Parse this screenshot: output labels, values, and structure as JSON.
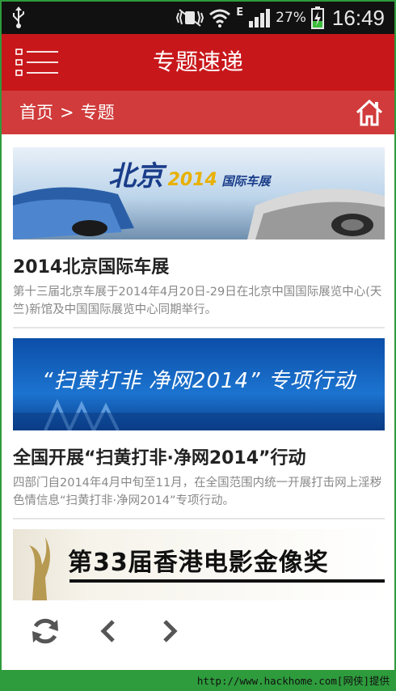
{
  "status_bar": {
    "network_type": "E",
    "battery_percent": "27%",
    "time": "16:49",
    "icons": [
      "usb-icon",
      "mute-vibrate-icon",
      "wifi-icon",
      "signal-icon",
      "battery-charging-icon"
    ]
  },
  "header": {
    "title": "专题速递",
    "menu_icon": "list-menu-icon"
  },
  "breadcrumb": {
    "home": "首页",
    "separator": ">",
    "current": "专题",
    "home_icon": "home-icon"
  },
  "articles": [
    {
      "banner_text": "北京",
      "banner_year": "2014",
      "banner_small": "国际车展",
      "title": "2014北京国际车展",
      "description": "第十三届北京车展于2014年4月20日-29日在北京中国国际展览中心(天竺)新馆及中国国际展览中心同期举行。"
    },
    {
      "banner_text": "“扫黄打非 净网2014” 专项行动",
      "title": "全国开展“扫黄打非·净网2014”行动",
      "description": "四部门自2014年4月中旬至11月，在全国范围内统一开展打击网上淫秽色情信息“扫黄打非·净网2014”专项行动。"
    },
    {
      "banner_text": "第33届香港电影金像奖"
    }
  ],
  "toolbar": {
    "icons": [
      "refresh-icon",
      "back-icon",
      "forward-icon"
    ]
  },
  "watermark": {
    "text": "http://www.hackhome.com[网侠]提供"
  },
  "colors": {
    "header_red": "#c8171b",
    "breadcrumb_red": "#d13b3b",
    "frame_green": "#2e9b3c"
  }
}
